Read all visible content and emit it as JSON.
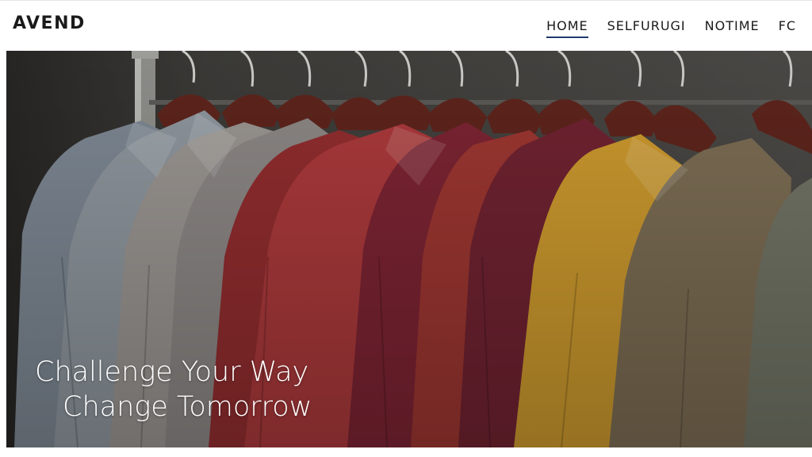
{
  "header": {
    "logo": "AVEND",
    "nav": [
      {
        "label": "HOME",
        "active": true
      },
      {
        "label": "SELFURUGI",
        "active": false
      },
      {
        "label": "NOTIME",
        "active": false
      },
      {
        "label": "FC",
        "active": false
      }
    ]
  },
  "hero": {
    "tagline_line1": "Challenge Your Way",
    "tagline_line2": "Change Tomorrow",
    "image": "clothing-rack-jackets-photo"
  },
  "colors": {
    "nav_active_underline": "#1f3a6e",
    "text": "#1a1a1a",
    "background": "#ffffff"
  }
}
